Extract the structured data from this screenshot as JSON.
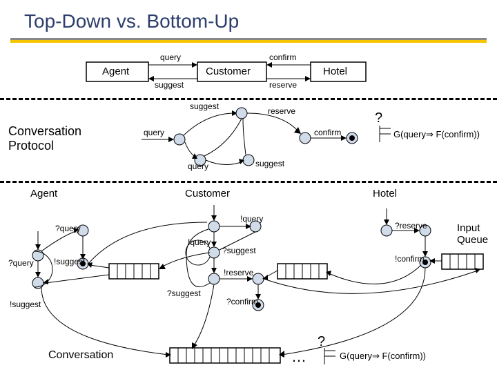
{
  "title": "Top-Down vs. Bottom-Up",
  "section1": {
    "agent": "Agent",
    "customer": "Customer",
    "hotel": "Hotel",
    "query": "query",
    "confirm": "confirm",
    "suggest": "suggest",
    "reserve": "reserve"
  },
  "section2": {
    "label": "Conversation\nProtocol",
    "suggest": "suggest",
    "reserve": "reserve",
    "query": "query",
    "confirm": "confirm",
    "query2": "query",
    "suggest2": "suggest",
    "formula": "G(query⇒ F(confirm))",
    "qmark": "?"
  },
  "section3": {
    "agent": "Agent",
    "customer": "Customer",
    "hotel": "Hotel",
    "qquery": "?query",
    "qquery2": "?query",
    "esuggest": "!suggest",
    "esuggest2": "!suggest",
    "equery_top": "!query",
    "equery": "!query",
    "qsuggest": "?suggest",
    "qsuggest2": "?suggest",
    "ereserve": "!reserve",
    "qconfirm": "?confirm",
    "qreserve": "?reserve",
    "econfirm": "!confirm",
    "inputqueue": "Input\nQueue"
  },
  "section4": {
    "conversation": "Conversation",
    "dots": "…",
    "qmark": "?",
    "formula": "G(query⇒ F(confirm))"
  }
}
